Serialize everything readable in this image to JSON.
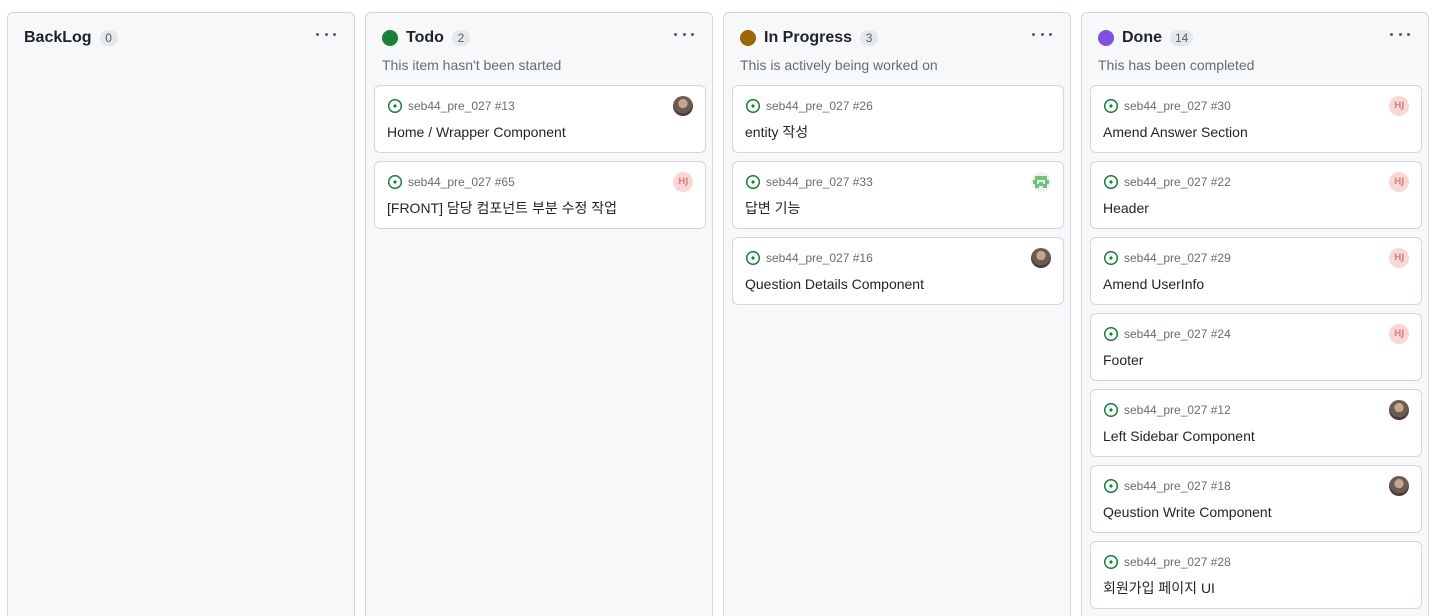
{
  "columns": [
    {
      "title": "BackLog",
      "count": "0",
      "color": "",
      "description": "",
      "cards": []
    },
    {
      "title": "Todo",
      "count": "2",
      "color": "#1a7f37",
      "description": "This item hasn't been started",
      "cards": [
        {
          "ref": "seb44_pre_027 #13",
          "title": "Home / Wrapper Component",
          "avatar": "photo"
        },
        {
          "ref": "seb44_pre_027 #65",
          "title": "[FRONT] 담당 컴포넌트 부분 수정 작업",
          "avatar": "hj"
        }
      ]
    },
    {
      "title": "In Progress",
      "count": "3",
      "color": "#9a6700",
      "description": "This is actively being worked on",
      "cards": [
        {
          "ref": "seb44_pre_027 #26",
          "title": "entity 작성",
          "avatar": ""
        },
        {
          "ref": "seb44_pre_027 #33",
          "title": "답변 기능",
          "avatar": "pixel"
        },
        {
          "ref": "seb44_pre_027 #16",
          "title": "Question Details Component",
          "avatar": "photo"
        }
      ]
    },
    {
      "title": "Done",
      "count": "14",
      "color": "#8250df",
      "description": "This has been completed",
      "cards": [
        {
          "ref": "seb44_pre_027 #30",
          "title": "Amend Answer Section",
          "avatar": "hj"
        },
        {
          "ref": "seb44_pre_027 #22",
          "title": "Header",
          "avatar": "hj"
        },
        {
          "ref": "seb44_pre_027 #29",
          "title": "Amend UserInfo",
          "avatar": "hj"
        },
        {
          "ref": "seb44_pre_027 #24",
          "title": "Footer",
          "avatar": "hj"
        },
        {
          "ref": "seb44_pre_027 #12",
          "title": "Left Sidebar Component",
          "avatar": "photo"
        },
        {
          "ref": "seb44_pre_027 #18",
          "title": "Qeustion Write Component",
          "avatar": "photo"
        },
        {
          "ref": "seb44_pre_027 #28",
          "title": "회원가입 페이지 UI",
          "avatar": ""
        }
      ]
    }
  ],
  "icons": {
    "issue": "issue-opened-icon",
    "menu": "kebab-horizontal-icon"
  },
  "colors": {
    "issue_open": "#1a7f37"
  }
}
